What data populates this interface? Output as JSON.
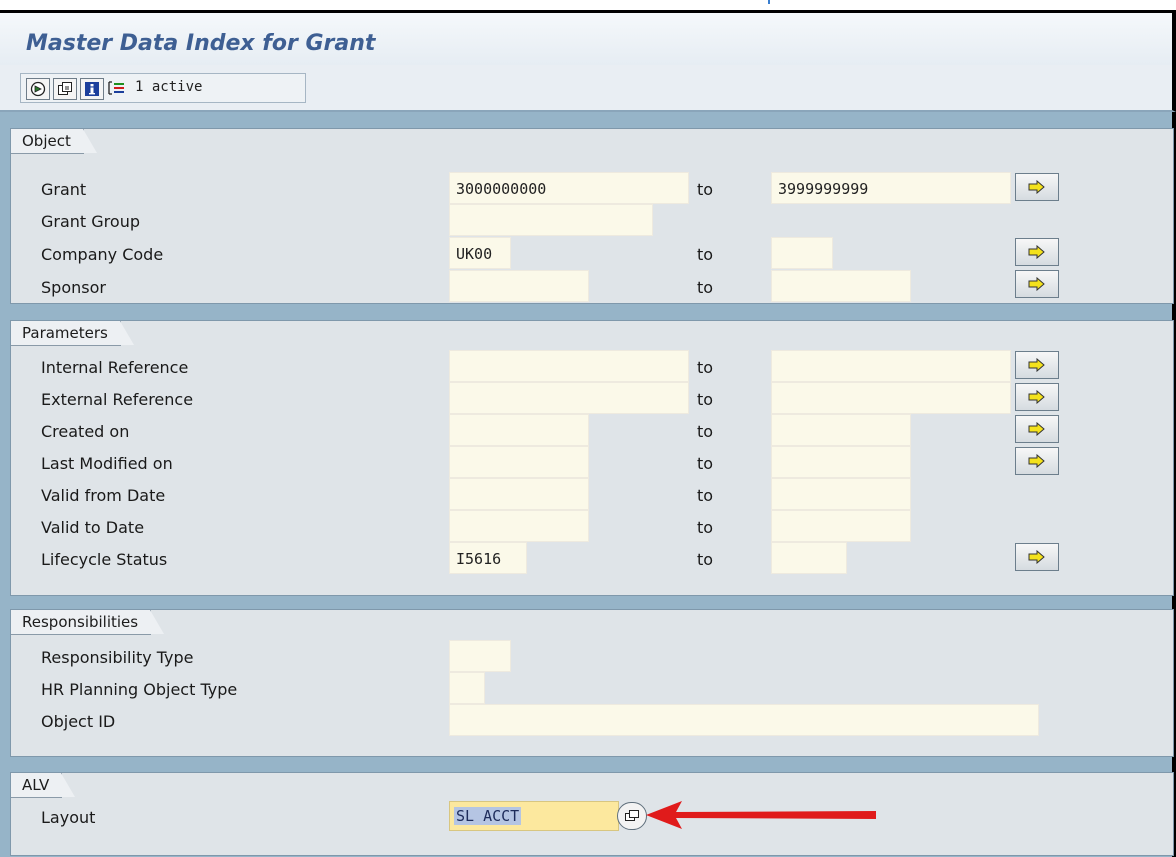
{
  "window": {
    "title": "Master Data Index for Grant"
  },
  "toolbar": {
    "buttons": [
      {
        "icon": "execute-icon"
      },
      {
        "icon": "copy-variant-icon"
      },
      {
        "icon": "info-icon"
      },
      {
        "icon": "dynamic-selections-icon"
      }
    ],
    "status_label": "1 active"
  },
  "sections": {
    "object": {
      "title": "Object",
      "rows": [
        {
          "label": "Grant",
          "from": "3000000000",
          "to_label": "to",
          "to": "3999999999"
        },
        {
          "label": "Grant Group",
          "from": ""
        },
        {
          "label": "Company Code",
          "from": "UK00",
          "to_label": "to",
          "to": ""
        },
        {
          "label": "Sponsor",
          "from": "",
          "to_label": "to",
          "to": ""
        }
      ]
    },
    "parameters": {
      "title": "Parameters",
      "rows": [
        {
          "label": "Internal Reference",
          "from": "",
          "to_label": "to",
          "to": ""
        },
        {
          "label": "External Reference",
          "from": "",
          "to_label": "to",
          "to": ""
        },
        {
          "label": "Created on",
          "from": "",
          "to_label": "to",
          "to": ""
        },
        {
          "label": "Last Modified on",
          "from": "",
          "to_label": "to",
          "to": ""
        },
        {
          "label": "Valid from Date",
          "from": "",
          "to_label": "to",
          "to": ""
        },
        {
          "label": "Valid to Date",
          "from": "",
          "to_label": "to",
          "to": ""
        },
        {
          "label": "Lifecycle Status",
          "from": "I5616",
          "to_label": "to",
          "to": ""
        }
      ]
    },
    "responsibilities": {
      "title": "Responsibilities",
      "rows": [
        {
          "label": "Responsibility Type",
          "from": ""
        },
        {
          "label": "HR Planning Object Type",
          "from": ""
        },
        {
          "label": "Object ID",
          "from": ""
        }
      ]
    },
    "alv": {
      "title": "ALV",
      "rows": [
        {
          "label": "Layout",
          "value": "SL ACCT"
        }
      ]
    }
  },
  "colors": {
    "title_text": "#3e5f93",
    "field_bg": "#fbf9e9",
    "layout_field_bg": "#fce89e",
    "annotation_arrow": "#e01b1b",
    "main_bg": "#96b4c8"
  }
}
